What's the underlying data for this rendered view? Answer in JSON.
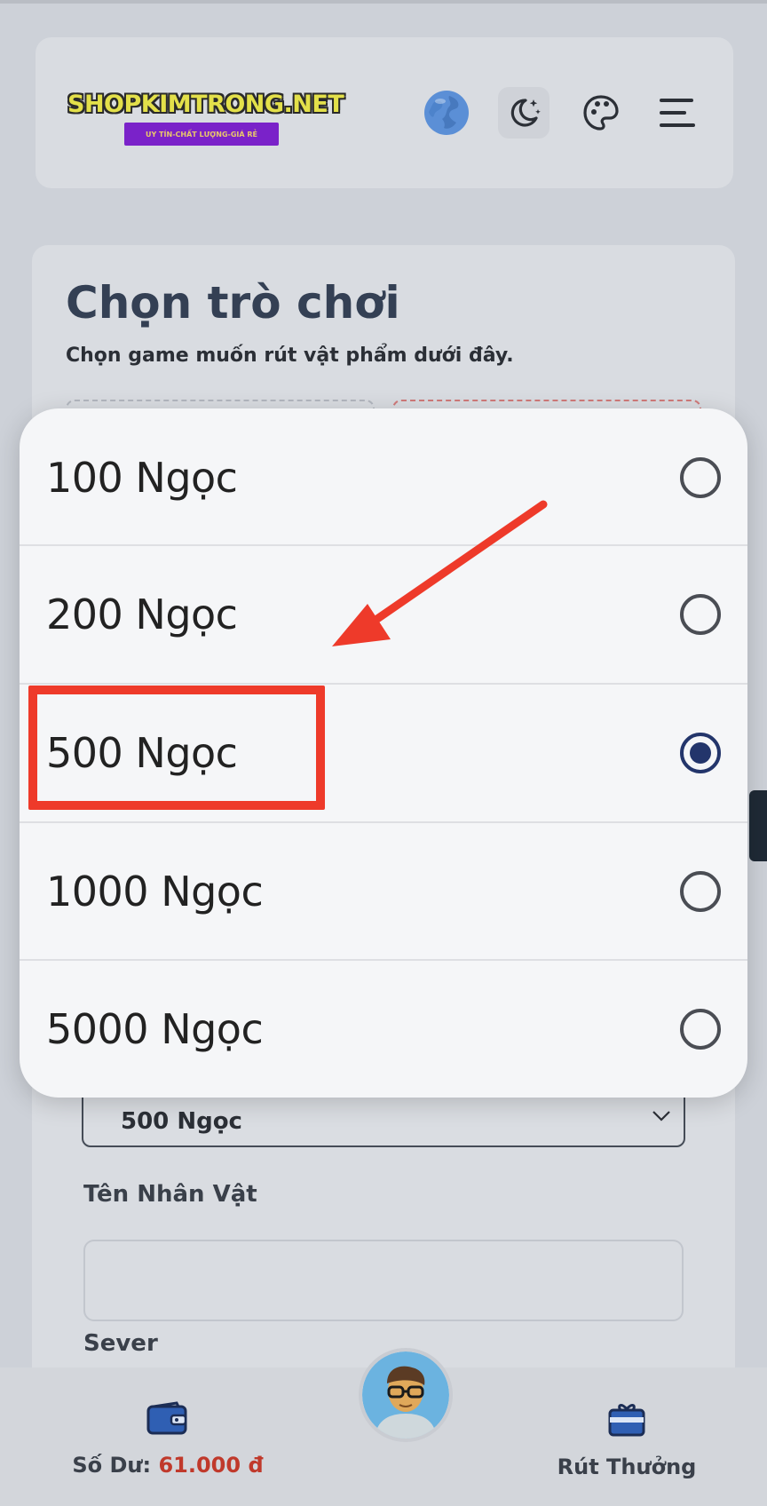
{
  "header": {
    "logo_text": "SHOPKIMTRONG.NET",
    "logo_tagline": "UY TÍN-CHẤT LƯỢNG-GIÁ RẺ",
    "icons": [
      "globe-icon",
      "moon-icon",
      "palette-icon",
      "menu-icon"
    ]
  },
  "page": {
    "title": "Chọn trò chơi",
    "subtitle": "Chọn game muốn rút vật phẩm dưới đây."
  },
  "form": {
    "selected_package": "500 Ngọc",
    "character_name_label": "Tên Nhân Vật",
    "character_name_value": "",
    "server_label": "Sever"
  },
  "picker": {
    "options": [
      {
        "label": "100 Ngọc",
        "selected": false
      },
      {
        "label": "200 Ngọc",
        "selected": false
      },
      {
        "label": "500 Ngọc",
        "selected": true
      },
      {
        "label": "1000 Ngọc",
        "selected": false
      },
      {
        "label": "5000 Ngọc",
        "selected": false
      }
    ]
  },
  "bottom_nav": {
    "balance_label": "Số Dư:",
    "balance_value": "61.000 đ",
    "reward_label": "Rút Thưởng"
  },
  "colors": {
    "accent_radio": "#23356b",
    "annotation_red": "#ee3a2a",
    "balance_red": "#c0392b"
  }
}
